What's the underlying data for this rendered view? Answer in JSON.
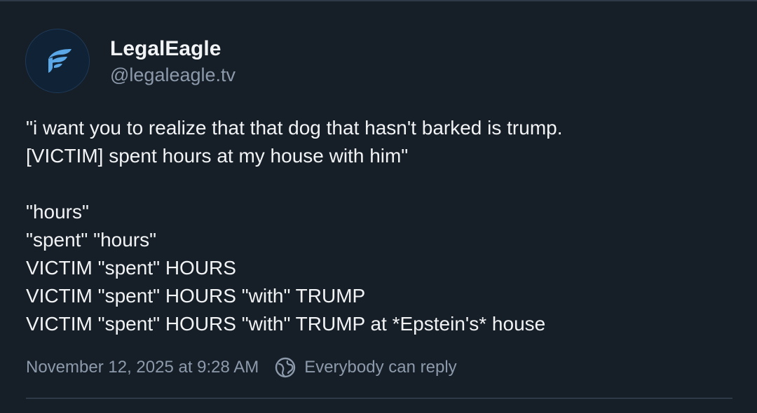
{
  "author": {
    "display_name": "LegalEagle",
    "handle": "@legaleagle.tv",
    "avatar_icon": "legaleagle-logo-icon",
    "brand_color": "#5aa8e8"
  },
  "post": {
    "lines": [
      "\"i want you to realize that that dog that hasn't barked is trump.",
      "[VICTIM] spent hours at my house with him\"",
      "",
      "\"hours\"",
      "\"spent\" \"hours\"",
      "VICTIM \"spent\" HOURS",
      "VICTIM \"spent\" HOURS \"with\" TRUMP",
      "VICTIM \"spent\" HOURS \"with\" TRUMP at *Epstein's* house"
    ]
  },
  "meta": {
    "timestamp": "November 12, 2025 at 9:28 AM",
    "reply_icon": "globe-icon",
    "reply_setting": "Everybody can reply"
  },
  "colors": {
    "background": "#161e27",
    "text": "#f1f3f5",
    "muted": "#8c9aab",
    "divider": "#2e3a48"
  }
}
